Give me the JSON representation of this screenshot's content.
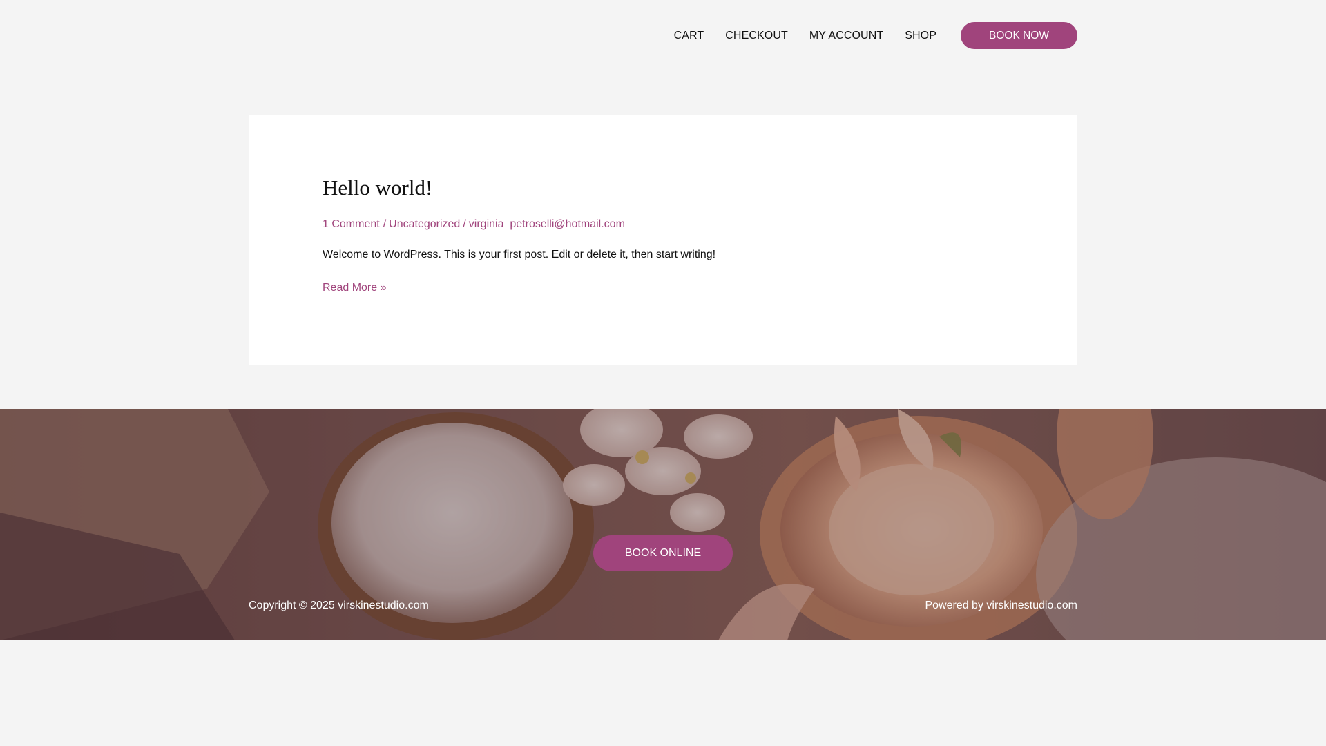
{
  "header": {
    "nav": {
      "cart": "CART",
      "checkout": "CHECKOUT",
      "my_account": "MY ACCOUNT",
      "shop": "SHOP"
    },
    "book_now_label": "BOOK NOW"
  },
  "post": {
    "title": "Hello world!",
    "meta": {
      "comments": "1 Comment",
      "category": "Uncategorized",
      "author": "virginia_petroselli@hotmail.com",
      "separator": "/"
    },
    "excerpt": "Welcome to WordPress. This is your first post. Edit or delete it, then start writing!",
    "read_more": "Read More »"
  },
  "footer": {
    "book_online_label": "BOOK ONLINE",
    "copyright": "Copyright © 2025 virskinestudio.com",
    "powered_by": "Powered by virskinestudio.com"
  },
  "colors": {
    "accent": "#a0447c",
    "page_background": "#f4f4f4",
    "card_background": "#ffffff",
    "text": "#111111"
  },
  "icons": {
    "footer_background": "spa-cosmetics-flowers-photo"
  }
}
